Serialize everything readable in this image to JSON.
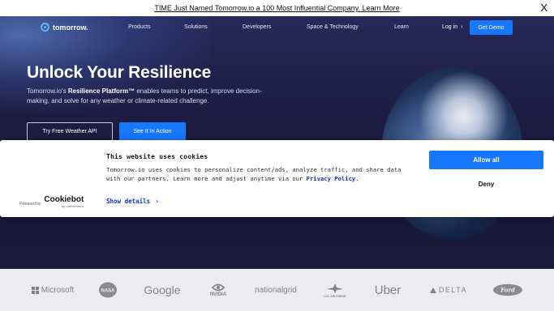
{
  "announcement": {
    "text": "TIME Just Named Tomorrow.io a 100 Most Influential Company. Learn More",
    "close": "X"
  },
  "nav": {
    "logo": "tomorrow.",
    "items": [
      "Products",
      "Solutions",
      "Developers",
      "Space & Technology",
      "Learn"
    ],
    "login": "Log in",
    "login_arrow": "›",
    "demo": "Get Demo"
  },
  "hero": {
    "title": "Unlock Your Resilience",
    "desc_prefix": "Tomorrow.io's ",
    "desc_bold": "Resilience Platform™",
    "desc_suffix": " enables teams to predict, improve decision-making, and solve for any weather or climate-related challenge.",
    "btn_api": "Try Free Weather API",
    "btn_action": "See It In Action"
  },
  "cookie": {
    "title": "This website uses cookies",
    "text": "Tomorrow.io uses cookies to personalize content/ads, analyze traffic, and share data with our partners. Learn more and adjust anytime via our ",
    "policy": "Privacy Policy",
    "period": ".",
    "details": "Show details",
    "details_arrow": "›",
    "powered_label": "Powered by",
    "brand": "Cookiebot",
    "brand_sub": "by Usercentrics",
    "allow": "Allow all",
    "deny": "Deny"
  },
  "logos": {
    "microsoft": "Microsoft",
    "nasa": "NASA",
    "google": "Google",
    "nvidia": "NVIDIA",
    "nationalgrid": "nationalgrid",
    "airforce": "U.S. AIR FORCE",
    "uber": "Uber",
    "delta": "DELTA",
    "ford": "Ford"
  },
  "colors": {
    "accent": "#1677ff",
    "hero_bg": "#1b1a3a",
    "link": "#1032cf",
    "logo_bar": "#ececef"
  }
}
